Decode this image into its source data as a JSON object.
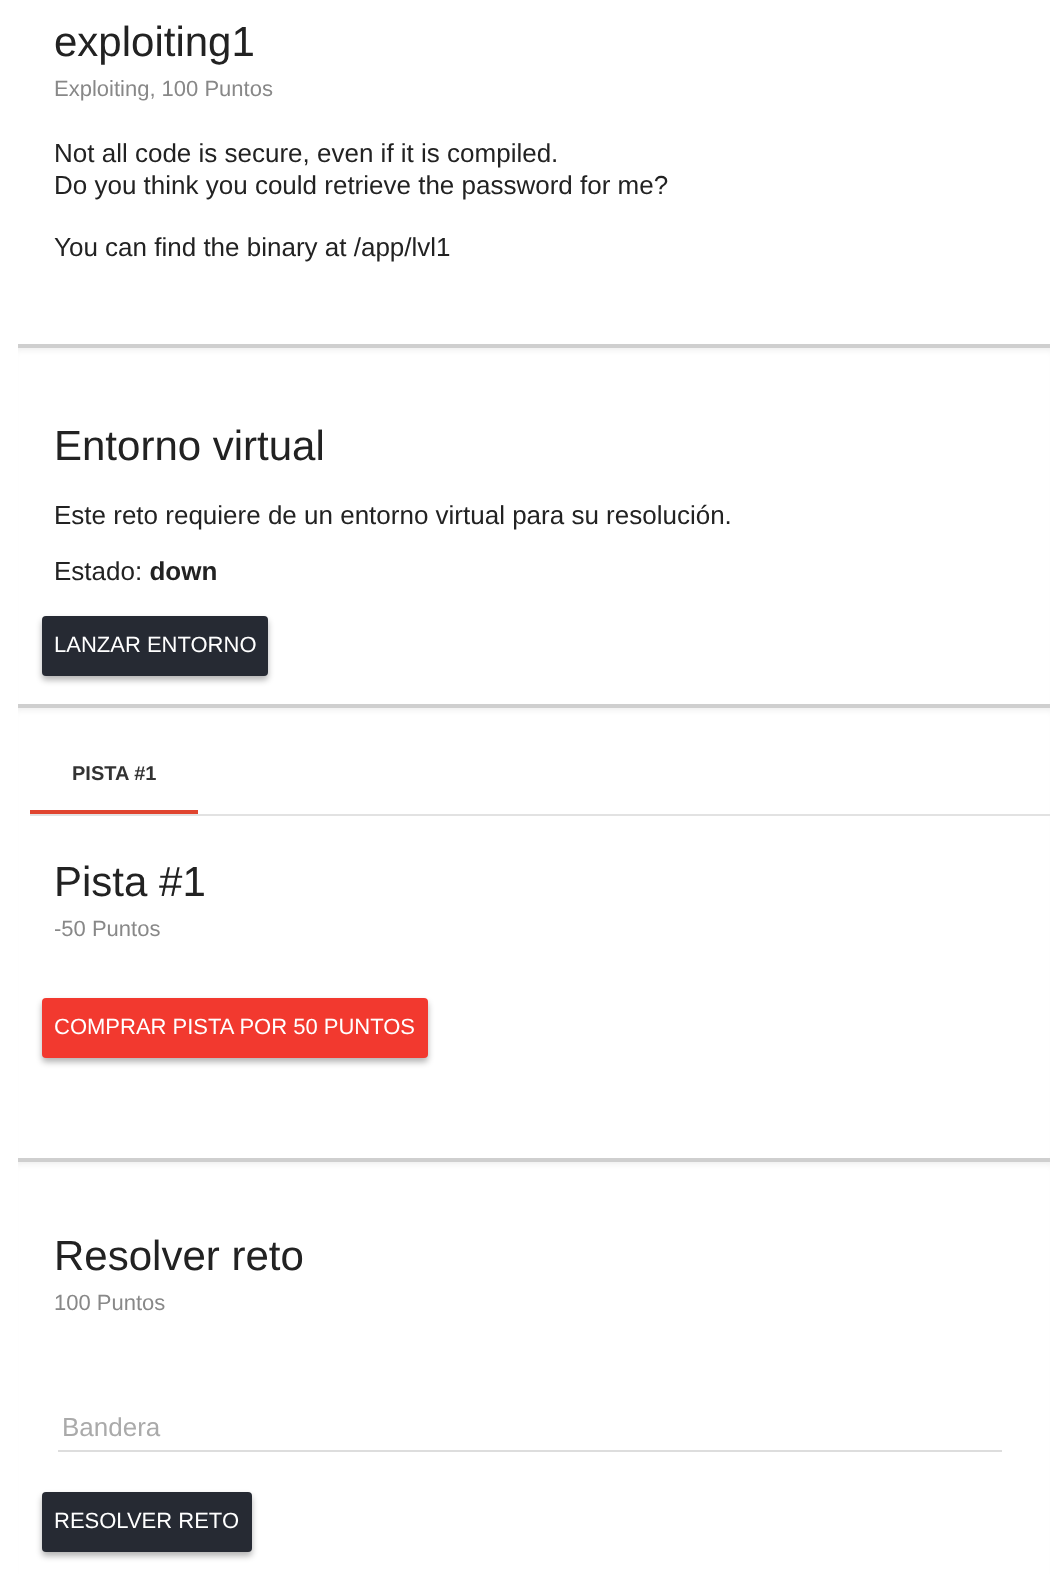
{
  "challenge": {
    "title": "exploiting1",
    "subtitle": "Exploiting, 100 Puntos",
    "description": [
      "Not all code is secure, even if it is compiled.",
      "Do you think you could retrieve the password for me?"
    ],
    "location": "You can find the binary at /app/lvl1"
  },
  "environment": {
    "title": "Entorno virtual",
    "text": "Este reto requiere de un entorno virtual para su resolución.",
    "status": "Estado: **down**",
    "button": "LANZAR ENTORNO"
  },
  "hints": {
    "tabs": [
      {
        "label": "PISTA #1",
        "selected": true
      }
    ],
    "title": "Pista #1",
    "cost": "-50 Puntos",
    "button": "COMPRAR PISTA POR 50 PUNTOS"
  },
  "solve": {
    "title": "Resolver reto",
    "points": "100 Puntos",
    "field": {
      "placeholder": "Bandera"
    },
    "button": "RESOLVER RETO"
  }
}
